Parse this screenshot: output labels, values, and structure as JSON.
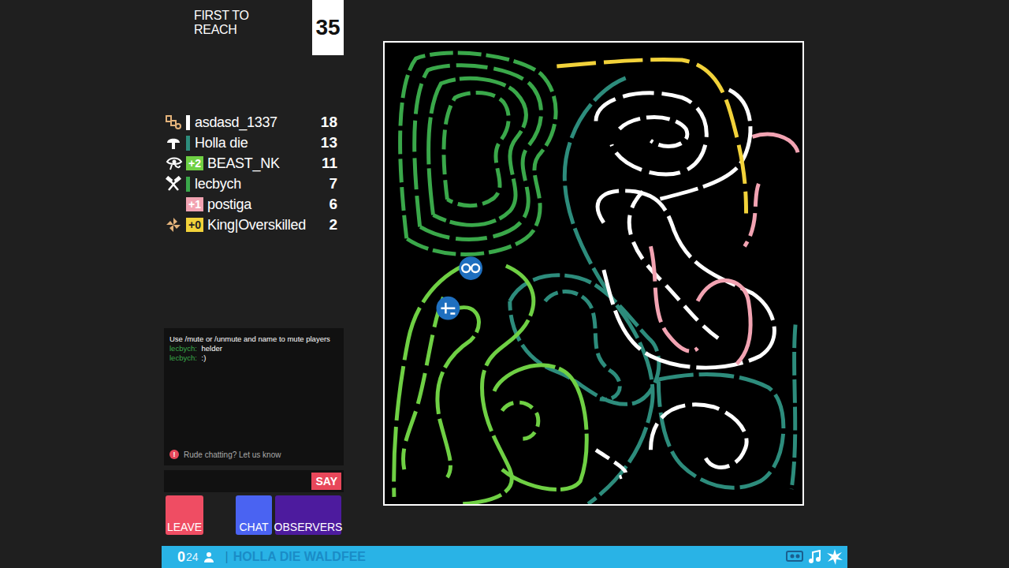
{
  "header": {
    "label": "FIRST TO REACH",
    "target": "35"
  },
  "players": [
    {
      "name": "asdasd_1337",
      "score": "18",
      "kind": "bar",
      "badge": "",
      "color": "#ffffff"
    },
    {
      "name": "Holla die",
      "score": "13",
      "kind": "bar",
      "badge": "",
      "color": "#2d8c7c"
    },
    {
      "name": "BEAST_NK",
      "score": "11",
      "kind": "badge",
      "badge": "+2",
      "color": "#6fd044"
    },
    {
      "name": "lecbych",
      "score": "7",
      "kind": "bar",
      "badge": "",
      "color": "#3aa84a"
    },
    {
      "name": "postiga",
      "score": "6",
      "kind": "badge",
      "badge": "+1",
      "color": "#f2a3b2"
    },
    {
      "name": "King|Overskilled",
      "score": "2",
      "kind": "badge",
      "badge": "+0",
      "color": "#f2d23a"
    }
  ],
  "chat": {
    "notice": "Use /mute or /unmute and name to mute players",
    "messages": [
      {
        "author": "lecbych:",
        "text": "helder",
        "color": "#3aa84a"
      },
      {
        "author": "lecbych:",
        "text": ":)",
        "color": "#3aa84a"
      }
    ],
    "report": "Rude chatting? Let us know",
    "report_icon": "!",
    "input_value": "",
    "send": "SAY"
  },
  "buttons": [
    {
      "label": "LEAVE",
      "color": "#ef4d63"
    },
    {
      "label": "CHAT",
      "color": "#4a63f2"
    },
    {
      "label": "OBSERVERS",
      "color": "#4d1b9e"
    }
  ],
  "status_bar": {
    "count_big": "0",
    "count_small": "24",
    "separator": "|",
    "title": "HOLLA DIE WALDFEE"
  }
}
